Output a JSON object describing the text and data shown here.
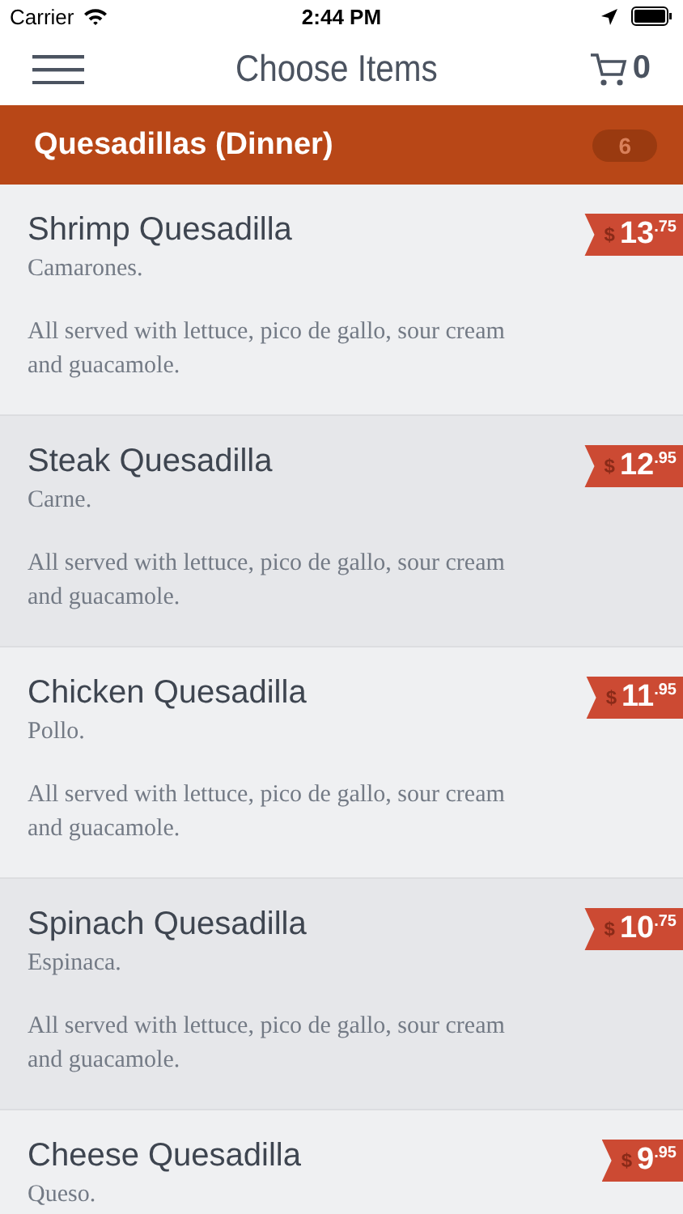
{
  "status_bar": {
    "carrier": "Carrier",
    "time": "2:44 PM"
  },
  "nav": {
    "title": "Choose Items",
    "cart_count": "0"
  },
  "category": {
    "title": "Quesadillas (Dinner)",
    "count": "6"
  },
  "items": [
    {
      "name": "Shrimp Quesadilla",
      "subtitle": "Camarones.",
      "description": "All served with lettuce, pico de gallo, sour cream and guacamole.",
      "currency": "$",
      "price": "13",
      "cents": ".75"
    },
    {
      "name": "Steak Quesadilla",
      "subtitle": "Carne.",
      "description": "All served with lettuce, pico de gallo, sour cream and guacamole.",
      "currency": "$",
      "price": "12",
      "cents": ".95"
    },
    {
      "name": "Chicken Quesadilla",
      "subtitle": "Pollo.",
      "description": "All served with lettuce, pico de gallo, sour cream and guacamole.",
      "currency": "$",
      "price": "11",
      "cents": ".95"
    },
    {
      "name": "Spinach Quesadilla",
      "subtitle": "Espinaca.",
      "description": "All served with lettuce, pico de gallo, sour cream and guacamole.",
      "currency": "$",
      "price": "10",
      "cents": ".75"
    },
    {
      "name": "Cheese Quesadilla",
      "subtitle": "Queso.",
      "currency": "$",
      "price": "9",
      "cents": ".95"
    }
  ]
}
